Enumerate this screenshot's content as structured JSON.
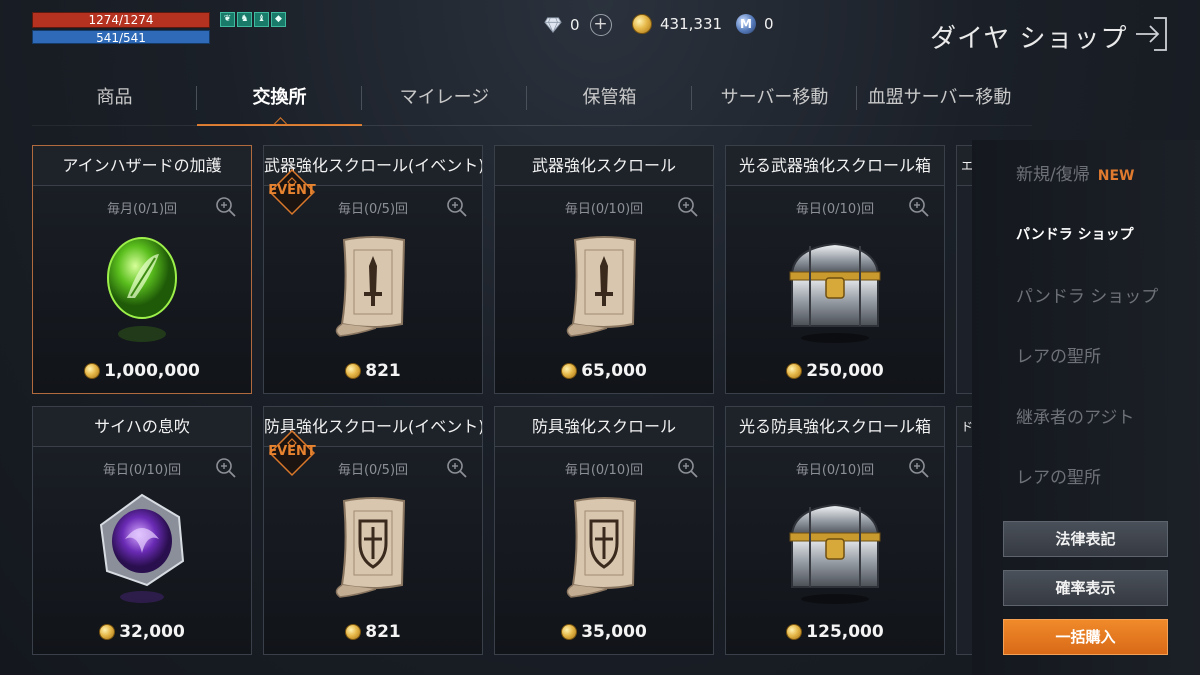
{
  "status": {
    "hp": "1274/1274",
    "hp_fraction": 1.0,
    "mp": "541/541",
    "mp_fraction": 1.0,
    "buff_icons": [
      "wing-icon",
      "figure-icon",
      "figure-icon",
      "crystal-icon"
    ]
  },
  "currencies": {
    "diamond": "0",
    "gold": "431,331",
    "mileage": "0",
    "mileage_icon_letter": "M"
  },
  "shop": {
    "title": "ダイヤ ショップ"
  },
  "tabs": [
    {
      "label": "商品",
      "active": false
    },
    {
      "label": "交換所",
      "active": true
    },
    {
      "label": "マイレージ",
      "active": false
    },
    {
      "label": "保管箱",
      "active": false
    },
    {
      "label": "サーバー移動",
      "active": false
    },
    {
      "label": "血盟サーバー移動",
      "active": false
    }
  ],
  "items": [
    {
      "title": "アインハザードの加護",
      "limit": "毎月(0/1)回",
      "price": "1,000,000",
      "event": false,
      "icon": "green-gem-icon",
      "selected": true
    },
    {
      "title": "武器強化スクロール(イベント)",
      "limit": "毎日(0/5)回",
      "price": "821",
      "event": true,
      "icon": "weapon-scroll-icon",
      "selected": false
    },
    {
      "title": "武器強化スクロール",
      "limit": "毎日(0/10)回",
      "price": "65,000",
      "event": false,
      "icon": "weapon-scroll-icon",
      "selected": false
    },
    {
      "title": "光る武器強化スクロール箱",
      "limit": "毎日(0/10)回",
      "price": "250,000",
      "event": false,
      "icon": "silver-chest-icon",
      "selected": false
    },
    {
      "title": "サイハの息吹",
      "limit": "毎日(0/10)回",
      "price": "32,000",
      "event": false,
      "icon": "purple-gem-icon",
      "selected": false
    },
    {
      "title": "防具強化スクロール(イベント)",
      "limit": "毎日(0/5)回",
      "price": "821",
      "event": true,
      "icon": "armor-scroll-icon",
      "selected": false
    },
    {
      "title": "防具強化スクロール",
      "limit": "毎日(0/10)回",
      "price": "35,000",
      "event": false,
      "icon": "armor-scroll-icon",
      "selected": false
    },
    {
      "title": "光る防具強化スクロール箱",
      "limit": "毎日(0/10)回",
      "price": "125,000",
      "event": false,
      "icon": "silver-chest-icon",
      "selected": false
    }
  ],
  "partial_items": [
    {
      "title": "エ"
    },
    {
      "title": "ド"
    }
  ],
  "event_label": "EVENT",
  "side_menu": {
    "items": [
      {
        "label": "新規/復帰",
        "tag": "NEW",
        "highlight": false
      },
      {
        "label": "パンドラ ショップ",
        "highlight": true
      },
      {
        "label": "パンドラ ショップ",
        "highlight": false
      },
      {
        "label": "レアの聖所",
        "highlight": false
      },
      {
        "label": "継承者のアジト",
        "highlight": false
      },
      {
        "label": "レアの聖所",
        "highlight": false
      }
    ],
    "legal_button": "法律表記",
    "probability_button": "確率表示",
    "bulk_buy_button": "一括購入"
  },
  "colors": {
    "accent": "#d9772a",
    "hp": "#b4321f",
    "mp": "#2e6ab7",
    "new_tag": "#e07a2e"
  }
}
